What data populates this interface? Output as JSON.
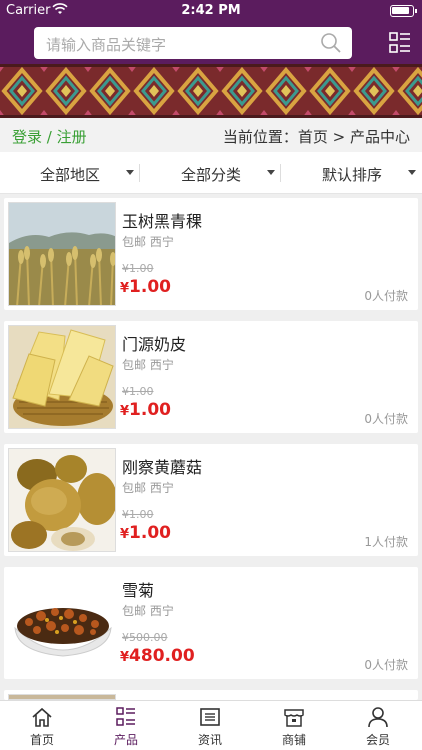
{
  "status_bar": {
    "carrier": "Carrier",
    "time": "2:42 PM",
    "battery_level": 0.9
  },
  "search": {
    "placeholder": "请输入商品关键字"
  },
  "login": {
    "text": "登录 / 注册"
  },
  "breadcrumb": {
    "text": "当前位置：首页 > 产品中心"
  },
  "filters": [
    "全部地区",
    "全部分类",
    "默认排序"
  ],
  "products": [
    {
      "name": "玉树黑青稞",
      "meta": "包邮  西宁",
      "old_price": "¥1.00",
      "price_symbol": "¥",
      "price": "1.00",
      "paid": "0人付款"
    },
    {
      "name": "门源奶皮",
      "meta": "包邮  西宁",
      "old_price": "¥1.00",
      "price_symbol": "¥",
      "price": "1.00",
      "paid": "0人付款"
    },
    {
      "name": "刚察黄蘑菇",
      "meta": "包邮  西宁",
      "old_price": "¥1.00",
      "price_symbol": "¥",
      "price": "1.00",
      "paid": "1人付款"
    },
    {
      "name": "雪菊",
      "meta": "包邮  西宁",
      "old_price": "¥500.00",
      "price_symbol": "¥",
      "price": "480.00",
      "paid": "0人付款"
    }
  ],
  "tabs": [
    {
      "label": "首页",
      "icon": "home-icon"
    },
    {
      "label": "产品",
      "icon": "product-list-icon",
      "active": true
    },
    {
      "label": "资讯",
      "icon": "news-icon"
    },
    {
      "label": "商铺",
      "icon": "shop-icon"
    },
    {
      "label": "会员",
      "icon": "member-icon"
    }
  ],
  "colors": {
    "brand": "#5b1c5e",
    "price": "#e02020",
    "login": "#3aa035"
  }
}
